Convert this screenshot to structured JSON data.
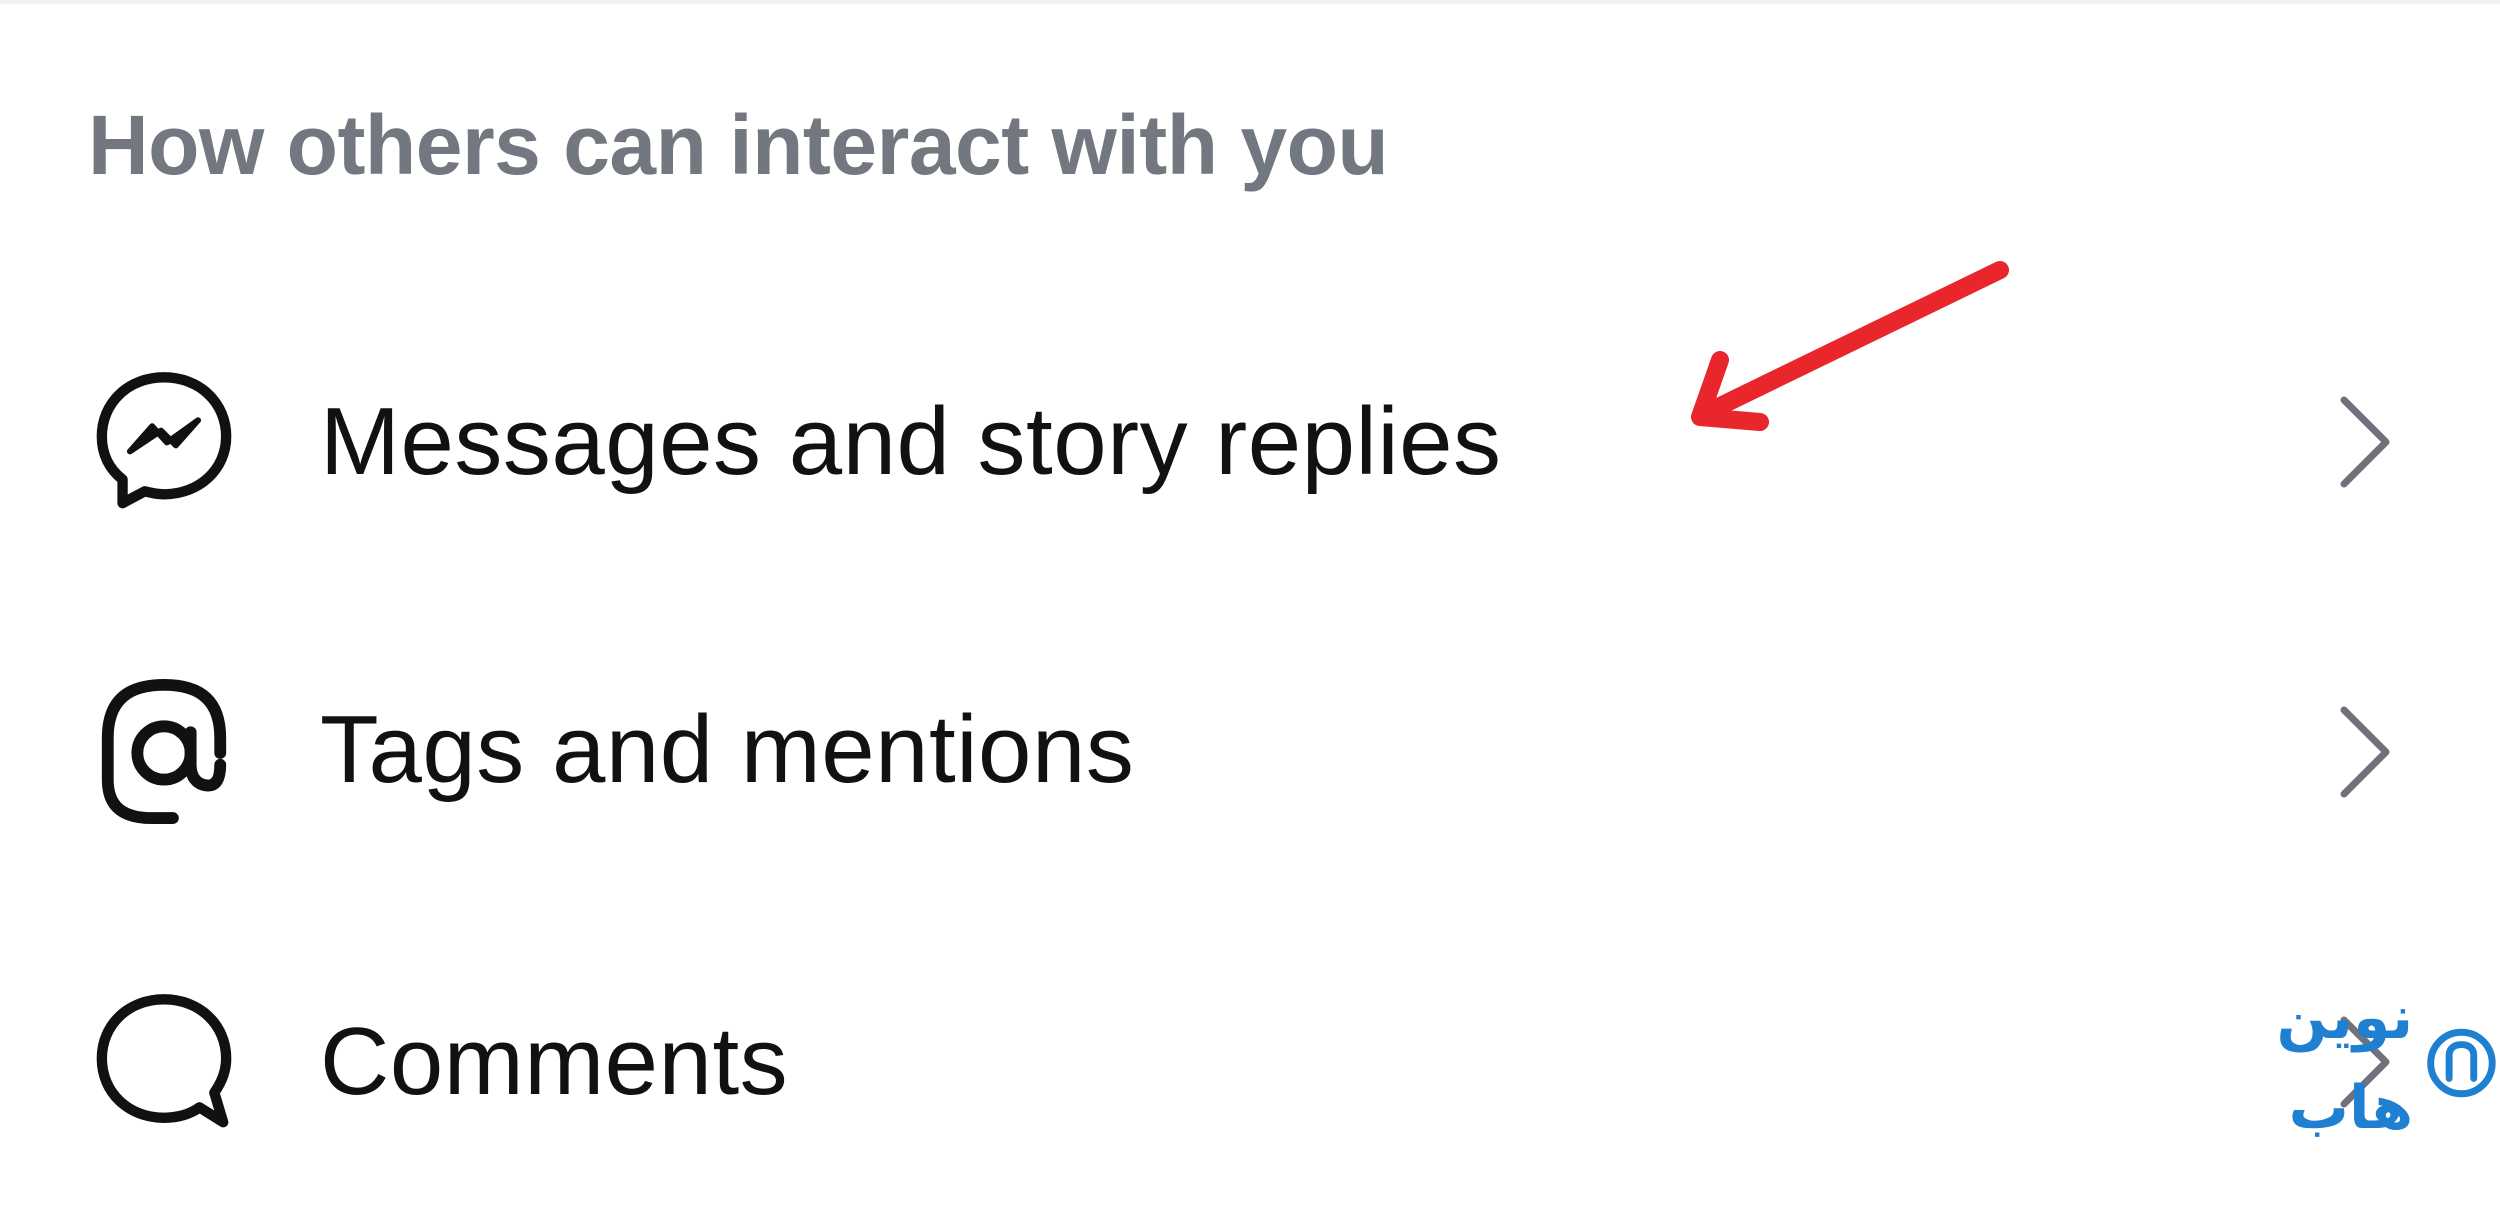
{
  "section": {
    "title": "How others can interact with you"
  },
  "rows": [
    {
      "label": "Messages and story replies",
      "icon": "messenger-icon"
    },
    {
      "label": "Tags and mentions",
      "icon": "at-sign-icon"
    },
    {
      "label": "Comments",
      "icon": "comment-bubble-icon"
    }
  ],
  "annotation": {
    "arrow_color": "#e8262b",
    "target": "messages-and-story-replies"
  },
  "watermark": {
    "text": "نوین هاب",
    "color": "#1f7fd0"
  },
  "colors": {
    "title": "#737780",
    "label": "#111111",
    "chevron": "#6f727a"
  }
}
